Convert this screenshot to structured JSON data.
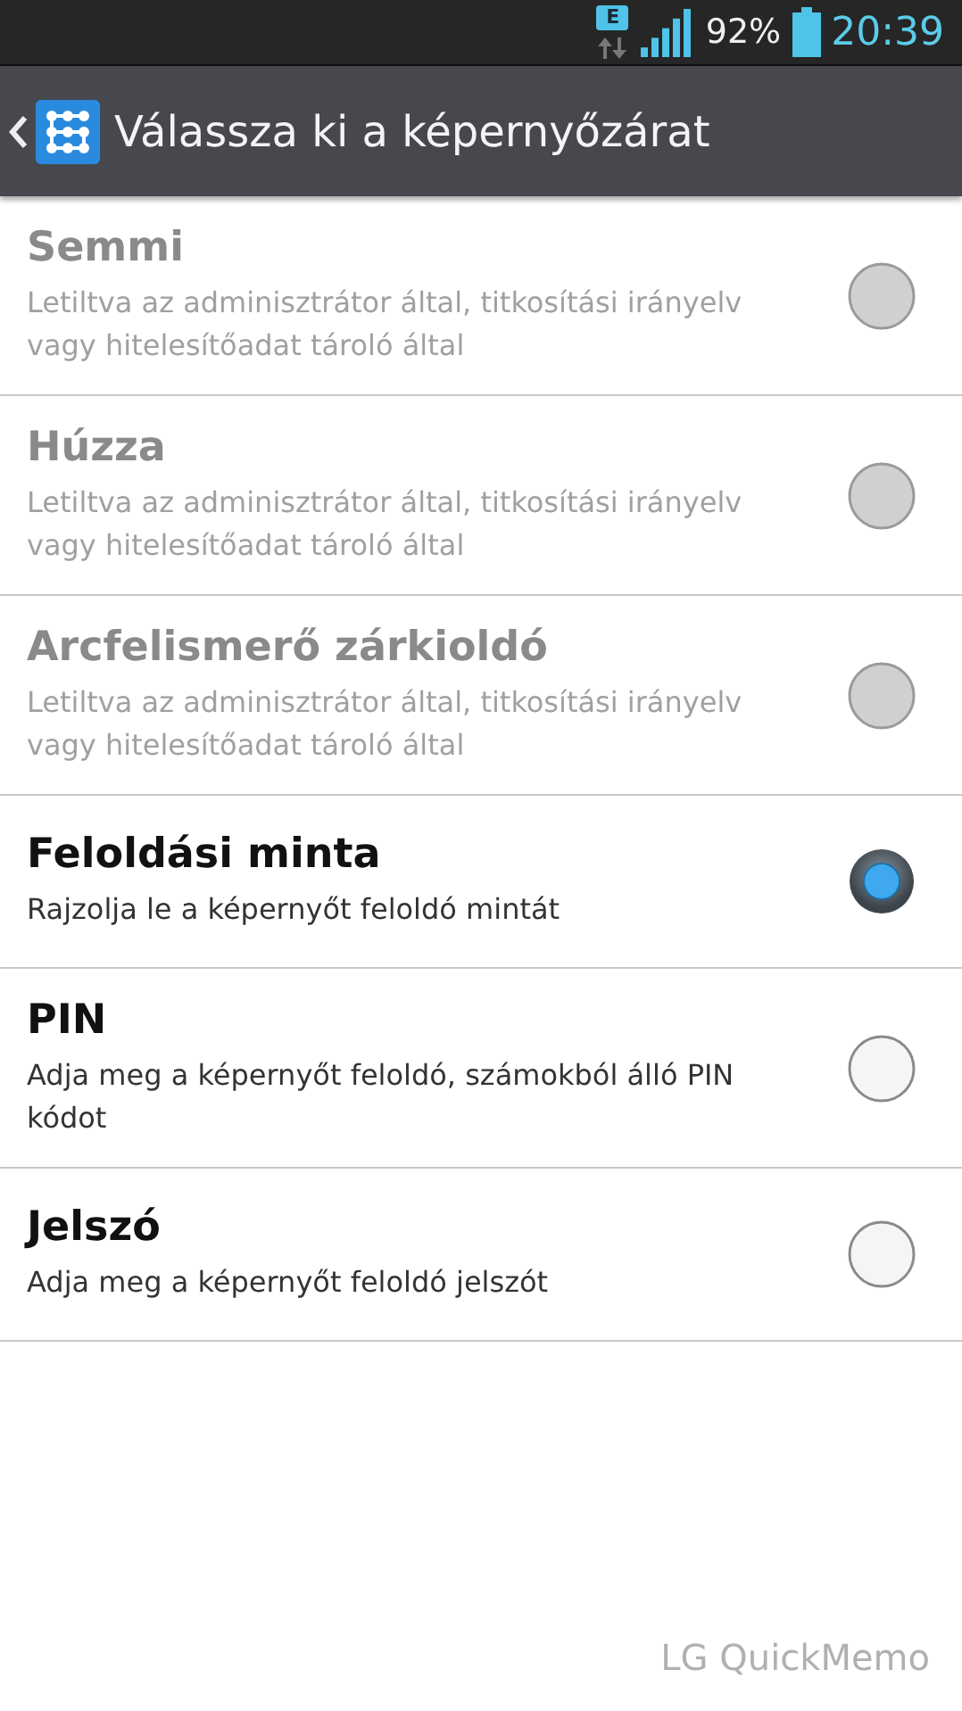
{
  "status_bar": {
    "network": "E",
    "battery_text": "92%",
    "time": "20:39"
  },
  "header": {
    "title": "Válassza ki a képernyőzárat"
  },
  "options": [
    {
      "title": "Semmi",
      "description": "Letiltva az adminisztrátor által, titkosítási irányelv vagy hitelesítőadat tároló által",
      "disabled": true,
      "selected": false
    },
    {
      "title": "Húzza",
      "description": "Letiltva az adminisztrátor által, titkosítási irányelv vagy hitelesítőadat tároló által",
      "disabled": true,
      "selected": false
    },
    {
      "title": "Arcfelismerő zárkioldó",
      "description": "Letiltva az adminisztrátor által, titkosítási irányelv vagy hitelesítőadat tároló által",
      "disabled": true,
      "selected": false
    },
    {
      "title": "Feloldási minta",
      "description": "Rajzolja le a képernyőt feloldó mintát",
      "disabled": false,
      "selected": true
    },
    {
      "title": "PIN",
      "description": "Adja meg a képernyőt feloldó, számokból álló PIN kódot",
      "disabled": false,
      "selected": false
    },
    {
      "title": "Jelszó",
      "description": "Adja meg a képernyőt feloldó jelszót",
      "disabled": false,
      "selected": false
    }
  ],
  "footer": {
    "label": "LG QuickMemo"
  }
}
